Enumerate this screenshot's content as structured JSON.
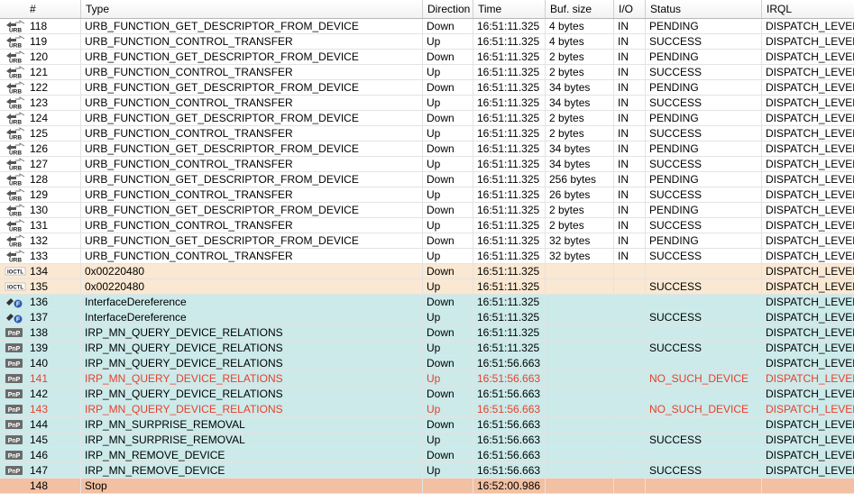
{
  "columns": {
    "num": "#",
    "type": "Type",
    "direction": "Direction",
    "time": "Time",
    "buf_size": "Buf. size",
    "io": "I/O",
    "status": "Status",
    "irql": "IRQL"
  },
  "icons": {
    "urb": "urb-icon",
    "ioctl": "ioctl-icon",
    "ifc": "interface-function-icon",
    "pnp": "pnp-icon"
  },
  "icon_labels": {
    "urb": "URB",
    "ioctl": "IOCTL",
    "pnp": "PnP",
    "ifc": "F"
  },
  "colors": {
    "urb_row": "#ffffff",
    "ioctl_row": "#fae8d2",
    "pnp_row": "#cceaea",
    "stop_row": "#f2c0a2",
    "error_text": "#e8402a"
  },
  "rows": [
    {
      "kind": "urb",
      "num": "118",
      "type": "URB_FUNCTION_GET_DESCRIPTOR_FROM_DEVICE",
      "direction": "Down",
      "time": "16:51:11.325",
      "buf": "4 bytes",
      "io": "IN",
      "status": "PENDING",
      "irql": "DISPATCH_LEVEL"
    },
    {
      "kind": "urb",
      "num": "119",
      "type": "URB_FUNCTION_CONTROL_TRANSFER",
      "direction": "Up",
      "time": "16:51:11.325",
      "buf": "4 bytes",
      "io": "IN",
      "status": "SUCCESS",
      "irql": "DISPATCH_LEVEL"
    },
    {
      "kind": "urb",
      "num": "120",
      "type": "URB_FUNCTION_GET_DESCRIPTOR_FROM_DEVICE",
      "direction": "Down",
      "time": "16:51:11.325",
      "buf": "2 bytes",
      "io": "IN",
      "status": "PENDING",
      "irql": "DISPATCH_LEVEL"
    },
    {
      "kind": "urb",
      "num": "121",
      "type": "URB_FUNCTION_CONTROL_TRANSFER",
      "direction": "Up",
      "time": "16:51:11.325",
      "buf": "2 bytes",
      "io": "IN",
      "status": "SUCCESS",
      "irql": "DISPATCH_LEVEL"
    },
    {
      "kind": "urb",
      "num": "122",
      "type": "URB_FUNCTION_GET_DESCRIPTOR_FROM_DEVICE",
      "direction": "Down",
      "time": "16:51:11.325",
      "buf": "34 bytes",
      "io": "IN",
      "status": "PENDING",
      "irql": "DISPATCH_LEVEL"
    },
    {
      "kind": "urb",
      "num": "123",
      "type": "URB_FUNCTION_CONTROL_TRANSFER",
      "direction": "Up",
      "time": "16:51:11.325",
      "buf": "34 bytes",
      "io": "IN",
      "status": "SUCCESS",
      "irql": "DISPATCH_LEVEL"
    },
    {
      "kind": "urb",
      "num": "124",
      "type": "URB_FUNCTION_GET_DESCRIPTOR_FROM_DEVICE",
      "direction": "Down",
      "time": "16:51:11.325",
      "buf": "2 bytes",
      "io": "IN",
      "status": "PENDING",
      "irql": "DISPATCH_LEVEL"
    },
    {
      "kind": "urb",
      "num": "125",
      "type": "URB_FUNCTION_CONTROL_TRANSFER",
      "direction": "Up",
      "time": "16:51:11.325",
      "buf": "2 bytes",
      "io": "IN",
      "status": "SUCCESS",
      "irql": "DISPATCH_LEVEL"
    },
    {
      "kind": "urb",
      "num": "126",
      "type": "URB_FUNCTION_GET_DESCRIPTOR_FROM_DEVICE",
      "direction": "Down",
      "time": "16:51:11.325",
      "buf": "34 bytes",
      "io": "IN",
      "status": "PENDING",
      "irql": "DISPATCH_LEVEL"
    },
    {
      "kind": "urb",
      "num": "127",
      "type": "URB_FUNCTION_CONTROL_TRANSFER",
      "direction": "Up",
      "time": "16:51:11.325",
      "buf": "34 bytes",
      "io": "IN",
      "status": "SUCCESS",
      "irql": "DISPATCH_LEVEL"
    },
    {
      "kind": "urb",
      "num": "128",
      "type": "URB_FUNCTION_GET_DESCRIPTOR_FROM_DEVICE",
      "direction": "Down",
      "time": "16:51:11.325",
      "buf": "256 bytes",
      "io": "IN",
      "status": "PENDING",
      "irql": "DISPATCH_LEVEL"
    },
    {
      "kind": "urb",
      "num": "129",
      "type": "URB_FUNCTION_CONTROL_TRANSFER",
      "direction": "Up",
      "time": "16:51:11.325",
      "buf": "26 bytes",
      "io": "IN",
      "status": "SUCCESS",
      "irql": "DISPATCH_LEVEL"
    },
    {
      "kind": "urb",
      "num": "130",
      "type": "URB_FUNCTION_GET_DESCRIPTOR_FROM_DEVICE",
      "direction": "Down",
      "time": "16:51:11.325",
      "buf": "2 bytes",
      "io": "IN",
      "status": "PENDING",
      "irql": "DISPATCH_LEVEL"
    },
    {
      "kind": "urb",
      "num": "131",
      "type": "URB_FUNCTION_CONTROL_TRANSFER",
      "direction": "Up",
      "time": "16:51:11.325",
      "buf": "2 bytes",
      "io": "IN",
      "status": "SUCCESS",
      "irql": "DISPATCH_LEVEL"
    },
    {
      "kind": "urb",
      "num": "132",
      "type": "URB_FUNCTION_GET_DESCRIPTOR_FROM_DEVICE",
      "direction": "Down",
      "time": "16:51:11.325",
      "buf": "32 bytes",
      "io": "IN",
      "status": "PENDING",
      "irql": "DISPATCH_LEVEL"
    },
    {
      "kind": "urb",
      "num": "133",
      "type": "URB_FUNCTION_CONTROL_TRANSFER",
      "direction": "Up",
      "time": "16:51:11.325",
      "buf": "32 bytes",
      "io": "IN",
      "status": "SUCCESS",
      "irql": "DISPATCH_LEVEL"
    },
    {
      "kind": "ioctl",
      "num": "134",
      "type": "0x00220480",
      "direction": "Down",
      "time": "16:51:11.325",
      "buf": "",
      "io": "",
      "status": "",
      "irql": "DISPATCH_LEVEL"
    },
    {
      "kind": "ioctl",
      "num": "135",
      "type": "0x00220480",
      "direction": "Up",
      "time": "16:51:11.325",
      "buf": "",
      "io": "",
      "status": "SUCCESS",
      "irql": "DISPATCH_LEVEL"
    },
    {
      "kind": "ifc",
      "num": "136",
      "type": "InterfaceDereference",
      "direction": "Down",
      "time": "16:51:11.325",
      "buf": "",
      "io": "",
      "status": "",
      "irql": "DISPATCH_LEVEL"
    },
    {
      "kind": "ifc",
      "num": "137",
      "type": "InterfaceDereference",
      "direction": "Up",
      "time": "16:51:11.325",
      "buf": "",
      "io": "",
      "status": "SUCCESS",
      "irql": "DISPATCH_LEVEL"
    },
    {
      "kind": "pnp",
      "num": "138",
      "type": "IRP_MN_QUERY_DEVICE_RELATIONS",
      "direction": "Down",
      "time": "16:51:11.325",
      "buf": "",
      "io": "",
      "status": "",
      "irql": "DISPATCH_LEVEL"
    },
    {
      "kind": "pnp",
      "num": "139",
      "type": "IRP_MN_QUERY_DEVICE_RELATIONS",
      "direction": "Up",
      "time": "16:51:11.325",
      "buf": "",
      "io": "",
      "status": "SUCCESS",
      "irql": "DISPATCH_LEVEL"
    },
    {
      "kind": "pnp",
      "num": "140",
      "type": "IRP_MN_QUERY_DEVICE_RELATIONS",
      "direction": "Down",
      "time": "16:51:56.663",
      "buf": "",
      "io": "",
      "status": "",
      "irql": "DISPATCH_LEVEL"
    },
    {
      "kind": "pnp",
      "num": "141",
      "type": "IRP_MN_QUERY_DEVICE_RELATIONS",
      "direction": "Up",
      "time": "16:51:56.663",
      "buf": "",
      "io": "",
      "status": "NO_SUCH_DEVICE",
      "irql": "DISPATCH_LEVEL",
      "error": true
    },
    {
      "kind": "pnp",
      "num": "142",
      "type": "IRP_MN_QUERY_DEVICE_RELATIONS",
      "direction": "Down",
      "time": "16:51:56.663",
      "buf": "",
      "io": "",
      "status": "",
      "irql": "DISPATCH_LEVEL"
    },
    {
      "kind": "pnp",
      "num": "143",
      "type": "IRP_MN_QUERY_DEVICE_RELATIONS",
      "direction": "Up",
      "time": "16:51:56.663",
      "buf": "",
      "io": "",
      "status": "NO_SUCH_DEVICE",
      "irql": "DISPATCH_LEVEL",
      "error": true
    },
    {
      "kind": "pnp",
      "num": "144",
      "type": "IRP_MN_SURPRISE_REMOVAL",
      "direction": "Down",
      "time": "16:51:56.663",
      "buf": "",
      "io": "",
      "status": "",
      "irql": "DISPATCH_LEVEL"
    },
    {
      "kind": "pnp",
      "num": "145",
      "type": "IRP_MN_SURPRISE_REMOVAL",
      "direction": "Up",
      "time": "16:51:56.663",
      "buf": "",
      "io": "",
      "status": "SUCCESS",
      "irql": "DISPATCH_LEVEL"
    },
    {
      "kind": "pnp",
      "num": "146",
      "type": "IRP_MN_REMOVE_DEVICE",
      "direction": "Down",
      "time": "16:51:56.663",
      "buf": "",
      "io": "",
      "status": "",
      "irql": "DISPATCH_LEVEL"
    },
    {
      "kind": "pnp",
      "num": "147",
      "type": "IRP_MN_REMOVE_DEVICE",
      "direction": "Up",
      "time": "16:51:56.663",
      "buf": "",
      "io": "",
      "status": "SUCCESS",
      "irql": "DISPATCH_LEVEL"
    },
    {
      "kind": "stop",
      "num": "148",
      "type": "Stop",
      "direction": "",
      "time": "16:52:00.986",
      "buf": "",
      "io": "",
      "status": "",
      "irql": ""
    }
  ]
}
